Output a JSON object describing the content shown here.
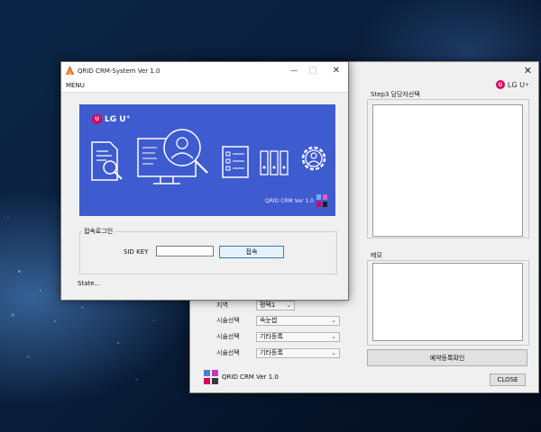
{
  "front_window": {
    "title": "QRID CRM-System Ver 1.0",
    "minimize": "—",
    "maximize": "□",
    "close": "✕",
    "menu": "MENU",
    "banner": {
      "logo_text": "LG U",
      "logo_plus": "+",
      "version_text": "QRID CRM Ver 1.0"
    },
    "login_group": {
      "title": "접속로그인",
      "sid_label": "SID KEY",
      "sid_value": "",
      "connect_button": "접속"
    },
    "status": "State..."
  },
  "back_window": {
    "close": "✕",
    "logo_text": "LG U",
    "logo_plus": "+",
    "step3_label": "Step3 담당자선택",
    "memo_label": "메모",
    "reserve_button": "예약등록확인",
    "close_button": "CLOSE",
    "footer_text": "QRID CRM Ver 1.0",
    "rows": [
      {
        "label": "지역",
        "value": "평택1"
      },
      {
        "label": "시술선택",
        "value": "속눈썹"
      },
      {
        "label": "시술선택",
        "value": "기타등록"
      },
      {
        "label": "시술선택",
        "value": "기타등록"
      }
    ]
  },
  "colors": {
    "banner_blue": "#3e5bd0",
    "brand_magenta": "#d6005a"
  }
}
